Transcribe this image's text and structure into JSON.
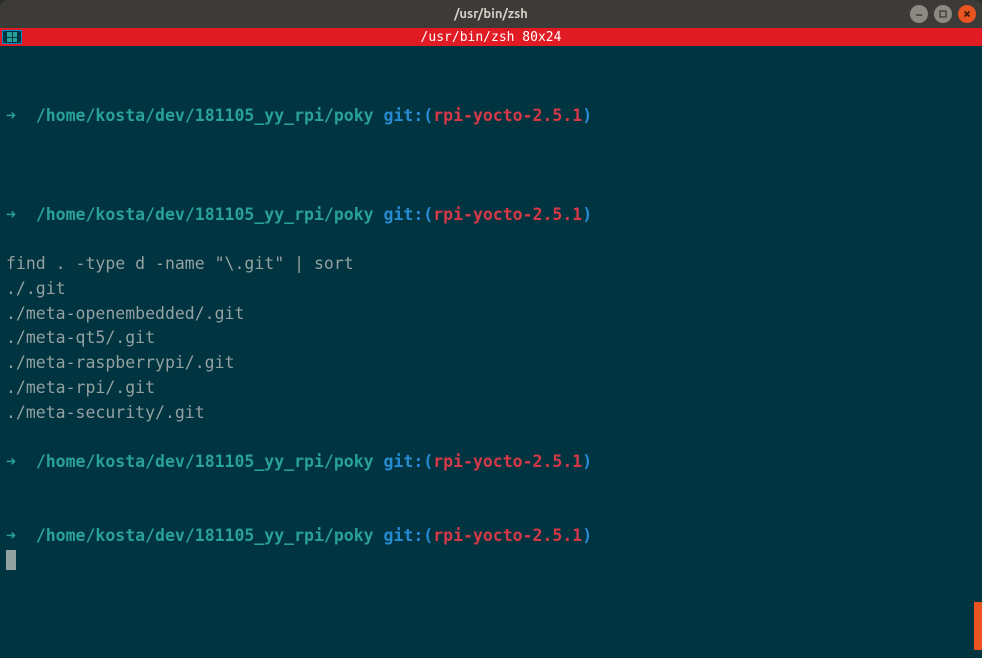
{
  "window": {
    "title": "/usr/bin/zsh"
  },
  "tab": {
    "title": "/usr/bin/zsh 80x24"
  },
  "prompt": {
    "arrow": "➜",
    "path": "/home/kosta/dev/181105_yy_rpi/poky",
    "git_label": "git:",
    "paren_open": "(",
    "branch": "rpi-yocto-2.5.1",
    "paren_close": ")"
  },
  "command": "find . -type d -name \"\\.git\" | sort",
  "output": [
    "./.git",
    "./meta-openembedded/.git",
    "./meta-qt5/.git",
    "./meta-raspberrypi/.git",
    "./meta-rpi/.git",
    "./meta-security/.git"
  ],
  "window_buttons": {
    "min": "–",
    "max": "□",
    "close": "✕"
  }
}
